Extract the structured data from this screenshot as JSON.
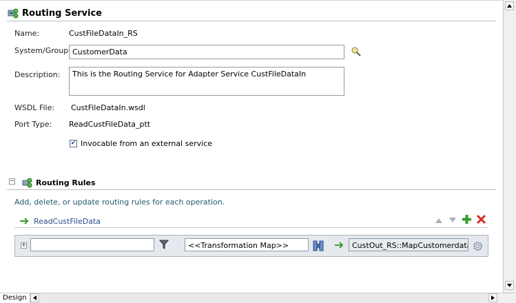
{
  "section": {
    "title": "Routing Service"
  },
  "form": {
    "name_label": "Name:",
    "name_value": "CustFileDataIn_RS",
    "system_label": "System/Group:",
    "system_value": "CustomerData",
    "description_label": "Description:",
    "description_value": "This is the Routing Service for Adapter Service CustFileDataIn",
    "wsdl_label": "WSDL File:",
    "wsdl_value": "CustFileDataIn.wsdl",
    "port_label": "Port Type:",
    "port_value": "ReadCustFileData_ptt",
    "invocable_label": "Invocable from an external service",
    "invocable_checked": true
  },
  "rules": {
    "collapse_symbol": "−",
    "title": "Routing Rules",
    "hint": "Add, delete, or update routing rules for each operation.",
    "operation": "ReadCustFileData",
    "expand_symbol": "+",
    "filter_value": "",
    "transformation_value": "<<Transformation Map>>",
    "target_value": "CustOut_RS::MapCustomerdata"
  },
  "bottom": {
    "tab_label": "Design"
  },
  "colors": {
    "accent_green": "#3c9a2d",
    "delete_red": "#d22b1e",
    "link_blue": "#2a4f8a"
  }
}
